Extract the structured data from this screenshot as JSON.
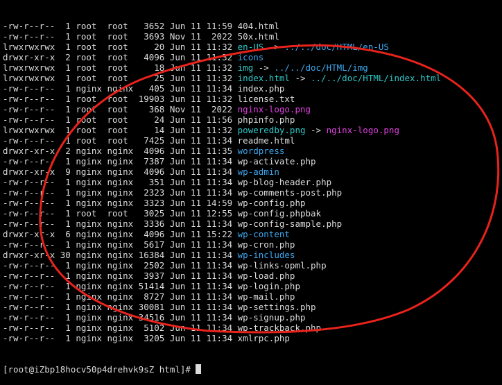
{
  "colors": {
    "background": "#000000",
    "text": "#dcdcdc",
    "directory": "#3ea8f0",
    "symlink": "#2ec8c8",
    "image": "#e040e0",
    "annotation": "#e8231b"
  },
  "listing": [
    {
      "meta": "-rw-r--r--  1 root  root   3652 Jun 11 11:59 ",
      "name": "404.html",
      "type": "file"
    },
    {
      "meta": "-rw-r--r--  1 root  root   3693 Nov 11  2022 ",
      "name": "50x.html",
      "type": "file"
    },
    {
      "meta": "lrwxrwxrwx  1 root  root     20 Jun 11 11:32 ",
      "name": "en-US",
      "type": "link",
      "target": "../../doc/HTML/en-US",
      "target_type": "dir"
    },
    {
      "meta": "drwxr-xr-x  2 root  root   4096 Jun 11 11:32 ",
      "name": "icons",
      "type": "dir"
    },
    {
      "meta": "lrwxrwxrwx  1 root  root     18 Jun 11 11:32 ",
      "name": "img",
      "type": "link",
      "target": "../../doc/HTML/img",
      "target_type": "dir"
    },
    {
      "meta": "lrwxrwxrwx  1 root  root     25 Jun 11 11:32 ",
      "name": "index.html",
      "type": "link",
      "target": "../../doc/HTML/index.html",
      "target_type": "link"
    },
    {
      "meta": "-rw-r--r--  1 nginx nginx   405 Jun 11 11:34 ",
      "name": "index.php",
      "type": "file"
    },
    {
      "meta": "-rw-r--r--  1 root  root  19903 Jun 11 11:32 ",
      "name": "license.txt",
      "type": "file"
    },
    {
      "meta": "-rw-r--r--  1 root  root    368 Nov 11  2022 ",
      "name": "nginx-logo.png",
      "type": "image"
    },
    {
      "meta": "-rw-r--r--  1 root  root     24 Jun 11 11:56 ",
      "name": "phpinfo.php",
      "type": "file"
    },
    {
      "meta": "lrwxrwxrwx  1 root  root     14 Jun 11 11:32 ",
      "name": "poweredby.png",
      "type": "link",
      "target": "nginx-logo.png",
      "target_type": "image"
    },
    {
      "meta": "-rw-r--r--  1 root  root   7425 Jun 11 11:34 ",
      "name": "readme.html",
      "type": "file"
    },
    {
      "meta": "drwxr-xr-x  2 nginx nginx  4096 Jun 11 11:35 ",
      "name": "wordpress",
      "type": "dir"
    },
    {
      "meta": "-rw-r--r--  1 nginx nginx  7387 Jun 11 11:34 ",
      "name": "wp-activate.php",
      "type": "file"
    },
    {
      "meta": "drwxr-xr-x  9 nginx nginx  4096 Jun 11 11:34 ",
      "name": "wp-admin",
      "type": "dir"
    },
    {
      "meta": "-rw-r--r--  1 nginx nginx   351 Jun 11 11:34 ",
      "name": "wp-blog-header.php",
      "type": "file"
    },
    {
      "meta": "-rw-r--r--  1 nginx nginx  2323 Jun 11 11:34 ",
      "name": "wp-comments-post.php",
      "type": "file"
    },
    {
      "meta": "-rw-r--r--  1 nginx nginx  3323 Jun 11 14:59 ",
      "name": "wp-config.php",
      "type": "file"
    },
    {
      "meta": "-rw-r--r--  1 root  root   3025 Jun 11 12:55 ",
      "name": "wp-config.phpbak",
      "type": "file"
    },
    {
      "meta": "-rw-r--r--  1 nginx nginx  3336 Jun 11 11:34 ",
      "name": "wp-config-sample.php",
      "type": "file"
    },
    {
      "meta": "drwxr-xr-x  6 nginx nginx  4096 Jun 11 15:22 ",
      "name": "wp-content",
      "type": "dir"
    },
    {
      "meta": "-rw-r--r--  1 nginx nginx  5617 Jun 11 11:34 ",
      "name": "wp-cron.php",
      "type": "file"
    },
    {
      "meta": "drwxr-xr-x 30 nginx nginx 16384 Jun 11 11:34 ",
      "name": "wp-includes",
      "type": "dir"
    },
    {
      "meta": "-rw-r--r--  1 nginx nginx  2502 Jun 11 11:34 ",
      "name": "wp-links-opml.php",
      "type": "file"
    },
    {
      "meta": "-rw-r--r--  1 nginx nginx  3937 Jun 11 11:34 ",
      "name": "wp-load.php",
      "type": "file"
    },
    {
      "meta": "-rw-r--r--  1 nginx nginx 51414 Jun 11 11:34 ",
      "name": "wp-login.php",
      "type": "file"
    },
    {
      "meta": "-rw-r--r--  1 nginx nginx  8727 Jun 11 11:34 ",
      "name": "wp-mail.php",
      "type": "file"
    },
    {
      "meta": "-rw-r--r--  1 nginx nginx 30081 Jun 11 11:34 ",
      "name": "wp-settings.php",
      "type": "file"
    },
    {
      "meta": "-rw-r--r--  1 nginx nginx 34516 Jun 11 11:34 ",
      "name": "wp-signup.php",
      "type": "file"
    },
    {
      "meta": "-rw-r--r--  1 nginx nginx  5102 Jun 11 11:34 ",
      "name": "wp-trackback.php",
      "type": "file"
    },
    {
      "meta": "-rw-r--r--  1 nginx nginx  3205 Jun 11 11:34 ",
      "name": "xmlrpc.php",
      "type": "file"
    }
  ],
  "link_arrow": " -> ",
  "prompt": "[root@iZbp18hocv50p4drehvk9sZ html]# "
}
